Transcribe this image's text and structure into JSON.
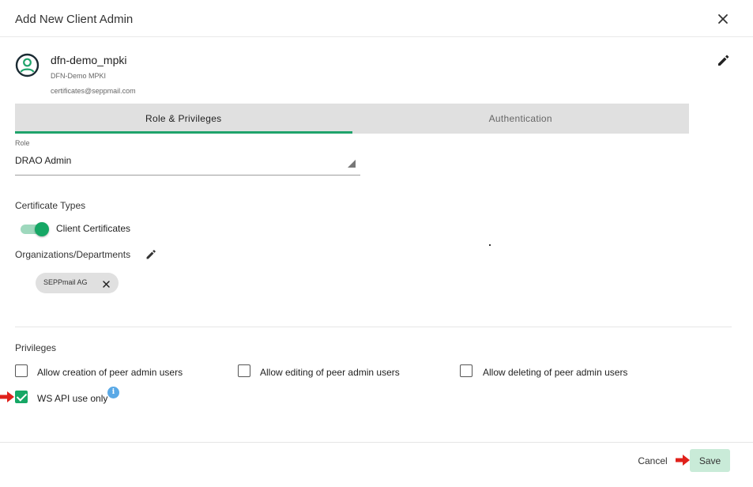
{
  "dialog": {
    "title": "Add New Client Admin"
  },
  "user": {
    "name": "dfn-demo_mpki",
    "organization": "DFN-Demo MPKI",
    "email": "certificates@seppmail.com"
  },
  "tabs": [
    {
      "label": "Role & Privileges",
      "active": true
    },
    {
      "label": "Authentication",
      "active": false
    }
  ],
  "role": {
    "label": "Role",
    "value": "DRAO Admin"
  },
  "certificate_types": {
    "label": "Certificate Types",
    "toggle": {
      "label": "Client Certificates",
      "on": true
    }
  },
  "organizations": {
    "label": "Organizations/Departments",
    "chips": [
      "SEPPmail AG"
    ]
  },
  "privileges": {
    "label": "Privileges",
    "items": [
      {
        "label": "Allow creation of peer admin users",
        "checked": false
      },
      {
        "label": "Allow editing of peer admin users",
        "checked": false
      },
      {
        "label": "Allow deleting of peer admin users",
        "checked": false
      },
      {
        "label": "WS API use only",
        "checked": true
      }
    ],
    "info_glyph": "i"
  },
  "footer": {
    "cancel_label": "Cancel",
    "save_label": "Save"
  },
  "colors": {
    "accent_green": "#16a765",
    "tab_indicator": "#1fa36b",
    "save_button_bg": "#c9ebd8",
    "annotation_arrow": "#e0211b",
    "info_blue": "#5aa9e6"
  },
  "icons": [
    "close-icon",
    "account-circle-icon",
    "pencil-icon",
    "dropdown-arrow-icon",
    "chip-remove-icon",
    "info-icon",
    "red-arrow-annotation"
  ]
}
